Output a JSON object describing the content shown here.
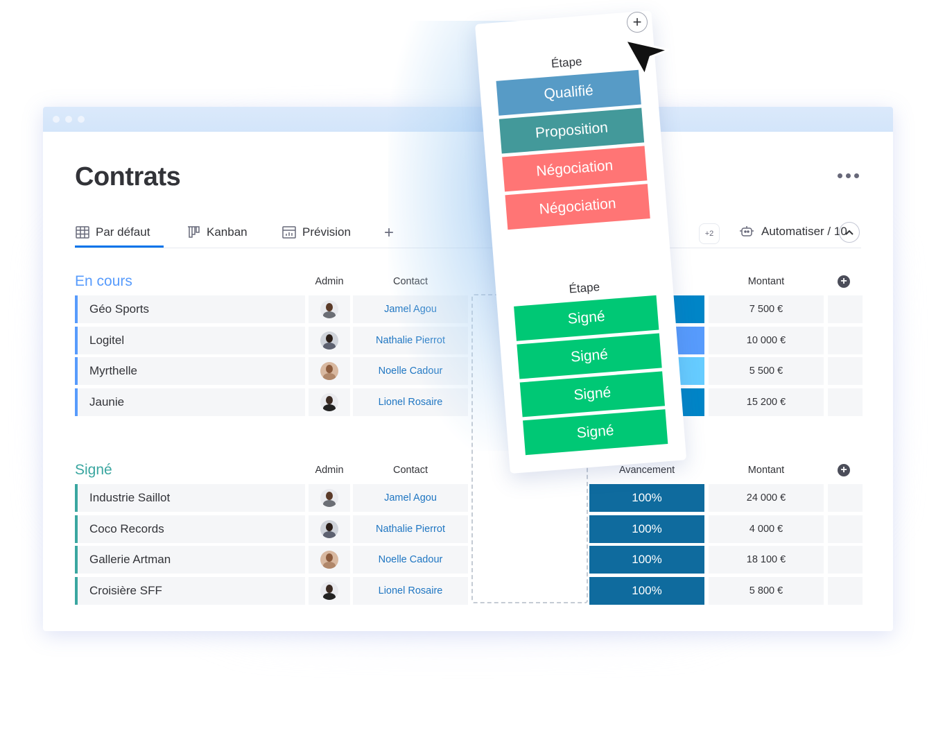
{
  "page": {
    "title": "Contrats",
    "more_icon": "more-horizontal-icon"
  },
  "tabs": [
    {
      "label": "Par défaut",
      "icon": "table-icon",
      "active": true
    },
    {
      "label": "Kanban",
      "icon": "kanban-icon",
      "active": false
    },
    {
      "label": "Prévision",
      "icon": "chart-icon",
      "active": false
    }
  ],
  "toolbar": {
    "add_tab": "+",
    "extra_count": "+2",
    "automate_label": "Automatiser / 10",
    "automate_icon": "robot-icon",
    "collapse_icon": "chevron-up-icon"
  },
  "colors": {
    "group_in_progress": "#579bfc",
    "group_signed": "#3aa6a0",
    "contact_link": "#1f76c2",
    "stage_qualified": "#579bc6",
    "stage_proposal": "#43999a",
    "stage_negotiation": "#ff7575",
    "stage_signed": "#00c875",
    "progress_full": "#0f6b9e"
  },
  "groups": [
    {
      "title": "En cours",
      "headers": {
        "admin": "Admin",
        "contact": "Contact",
        "progress": "",
        "amount": "Montant"
      },
      "rows": [
        {
          "name": "Géo Sports",
          "contact": "Jamel Agou",
          "progress_color": "#0085c7",
          "amount": "7 500 €"
        },
        {
          "name": "Logitel",
          "contact": "Nathalie Pierrot",
          "progress_color": "#579bfc",
          "amount": "10 000 €"
        },
        {
          "name": "Myrthelle",
          "contact": "Noelle Cadour",
          "progress_color": "#66ccff",
          "amount": "5 500 €"
        },
        {
          "name": "Jaunie",
          "contact": "Lionel Rosaire",
          "progress_color": "#0085c7",
          "amount": "15 200 €"
        }
      ]
    },
    {
      "title": "Signé",
      "headers": {
        "admin": "Admin",
        "contact": "Contact",
        "progress": "Avancement",
        "amount": "Montant"
      },
      "rows": [
        {
          "name": "Industrie Saillot",
          "contact": "Jamel Agou",
          "progress": "100%",
          "amount": "24 000 €"
        },
        {
          "name": "Coco Records",
          "contact": "Nathalie Pierrot",
          "progress": "100%",
          "amount": "4 000 €"
        },
        {
          "name": "Gallerie Artman",
          "contact": "Noelle Cadour",
          "progress": "100%",
          "amount": "18 100 €"
        },
        {
          "name": "Croisière SFF",
          "contact": "Lionel Rosaire",
          "progress": "100%",
          "amount": "5 800 €"
        }
      ]
    }
  ],
  "dragged_column": {
    "top_label": "Étape",
    "top_stages": [
      "Qualifié",
      "Proposition",
      "Négociation",
      "Négociation"
    ],
    "bottom_label": "Étape",
    "bottom_stages": [
      "Signé",
      "Signé",
      "Signé",
      "Signé"
    ]
  }
}
